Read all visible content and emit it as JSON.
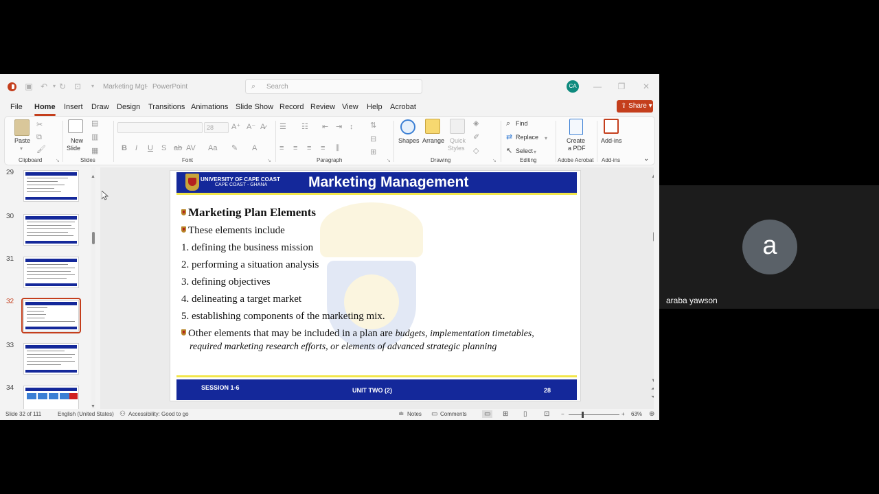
{
  "titlebar": {
    "doc_title": "Marketing Mgt",
    "app_sep": "-",
    "app_name": "PowerPoint",
    "search_placeholder": "Search",
    "user_initials": "CA"
  },
  "menu": {
    "tabs": [
      "File",
      "Home",
      "Insert",
      "Draw",
      "Design",
      "Transitions",
      "Animations",
      "Slide Show",
      "Record",
      "Review",
      "View",
      "Help",
      "Acrobat"
    ],
    "share_label": "Share"
  },
  "ribbon": {
    "paste": "Paste",
    "new_slide": "New",
    "new_slide_2": "Slide",
    "font_size": "28",
    "shapes": "Shapes",
    "arrange": "Arrange",
    "quick_styles": "Quick",
    "quick_styles_2": "Styles",
    "find": "Find",
    "replace": "Replace",
    "select": "Select",
    "create_pdf": "Create",
    "create_pdf_2": "a PDF",
    "add_ins": "Add-ins",
    "groups": {
      "clipboard": "Clipboard",
      "slides": "Slides",
      "font": "Font",
      "paragraph": "Paragraph",
      "drawing": "Drawing",
      "editing": "Editing",
      "adobe": "Adobe Acrobat",
      "addins": "Add-ins"
    }
  },
  "thumbnails": {
    "numbers": [
      "29",
      "30",
      "31",
      "32",
      "33",
      "34"
    ],
    "selected": "32"
  },
  "slide": {
    "university": "UNIVERSITY OF CAPE COAST",
    "location": "CAPE COAST - GHANA",
    "title": "Marketing Management",
    "heading": "Marketing Plan Elements",
    "intro": "These elements include",
    "items": [
      "1. defining the business mission",
      "2. performing a situation analysis",
      "3. defining objectives",
      "4. delineating a target market",
      "5. establishing components of  the marketing mix."
    ],
    "other_prefix": "Other elements that may be included in a plan are ",
    "other_italic_1": "budgets, implementation timetables,",
    "other_italic_2": "required marketing research efforts, or elements of  advanced strategic planning",
    "footer_left": "SESSION 1-6",
    "footer_center": "UNIT TWO (2)",
    "footer_right": "28"
  },
  "statusbar": {
    "slide_info": "Slide 32 of 111",
    "language": "English (United States)",
    "accessibility": "Accessibility: Good to go",
    "notes": "Notes",
    "comments": "Comments",
    "zoom": "63%"
  },
  "participant": {
    "initial": "a",
    "name": "araba yawson"
  },
  "colors": {
    "accent": "#c43e1c",
    "slide_blue": "#14289a",
    "slide_yellow": "#f2e64a"
  }
}
